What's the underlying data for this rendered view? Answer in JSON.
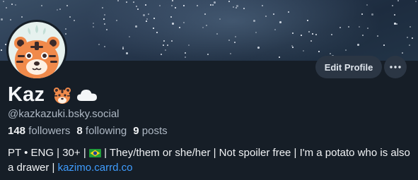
{
  "banner": {
    "colors": {
      "base": "#2a3b52",
      "stars": "#e8eef6"
    }
  },
  "profile": {
    "display_name": "Kaz",
    "name_emojis": [
      "tiger-face-icon",
      "cloud-icon"
    ],
    "handle": "@kazkazuki.bsky.social",
    "avatar_icon": "tiger-avatar"
  },
  "actions": {
    "edit_profile_label": "Edit Profile",
    "more_icon": "ellipsis-icon"
  },
  "stats": {
    "followers_count": "148",
    "followers_label": "followers",
    "following_count": "8",
    "following_label": "following",
    "posts_count": "9",
    "posts_label": "posts"
  },
  "bio": {
    "part1": "PT • ENG | 30+ | ",
    "flag_icon": "brazil-flag-icon",
    "part2": " | They/them or she/her | Not spoiler free | I'm a potato who is also a drawer | ",
    "link_text": "kazimo.carrd.co"
  },
  "colors": {
    "background": "#161e27",
    "button": "#2b3644",
    "link": "#3f9dff",
    "muted_text": "#aeb8c4"
  }
}
